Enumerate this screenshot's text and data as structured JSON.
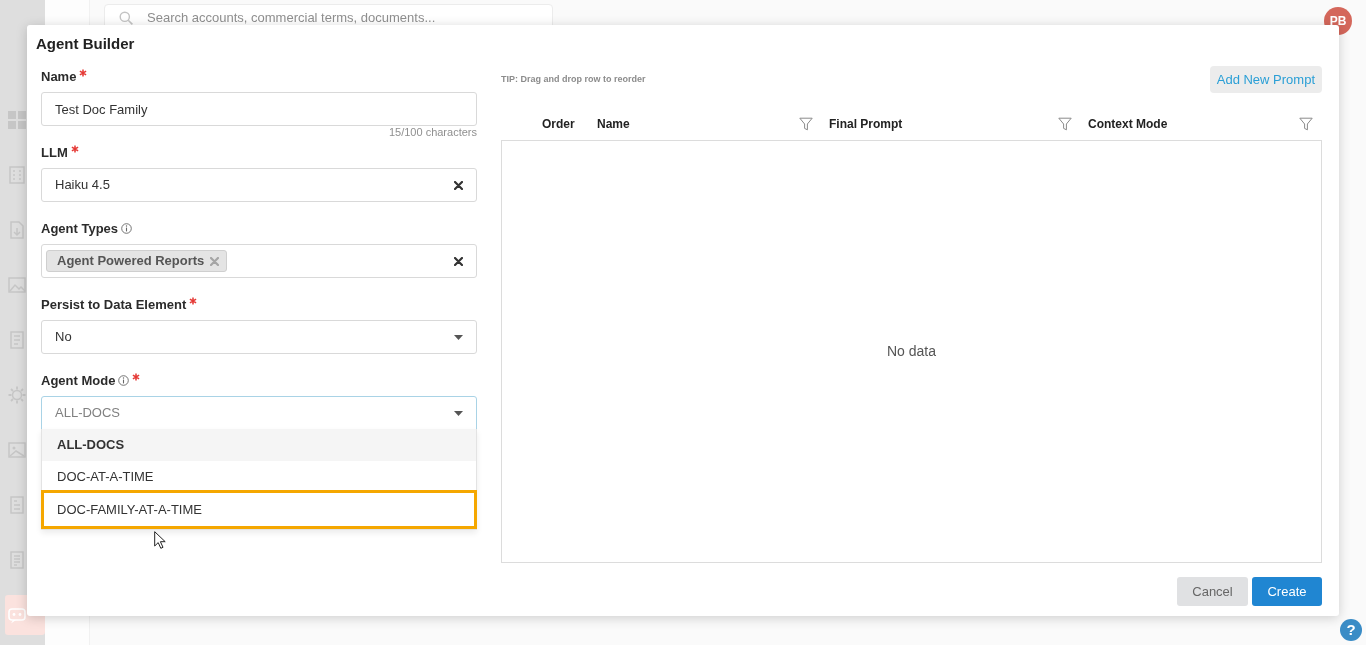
{
  "background": {
    "sidebar": {
      "items": [
        {
          "selected": false
        },
        {
          "selected": false
        },
        {
          "selected": false
        },
        {
          "selected": false
        },
        {
          "selected": false
        },
        {
          "selected": false
        },
        {
          "selected": false
        },
        {
          "selected": false
        },
        {
          "selected": false
        },
        {
          "selected": true
        }
      ]
    },
    "search": {
      "placeholder": "Search accounts, commercial terms, documents..."
    },
    "avatar": {
      "initials": "PB"
    },
    "help_button": {
      "label": "?"
    }
  },
  "dialog": {
    "title": "Agent Builder",
    "fields": [
      {
        "kind": "text",
        "label": "Name",
        "required": true,
        "value": "Test Doc Family",
        "counter": "15/100 characters"
      },
      {
        "kind": "select",
        "label": "LLM",
        "required": true,
        "value": "Haiku 4.5",
        "clearable": true,
        "open": false
      },
      {
        "kind": "multiselect",
        "label": "Agent Types",
        "info": true,
        "tags": [
          "Agent Powered Reports"
        ],
        "clearable": true
      },
      {
        "kind": "select",
        "label": "Persist to Data Element",
        "required": true,
        "value": "No",
        "clearable": false,
        "open": false
      },
      {
        "kind": "select",
        "label": "Agent Mode",
        "required": true,
        "info": true,
        "value": "ALL-DOCS",
        "clearable": false,
        "open": true,
        "options": [
          {
            "label": "ALL-DOCS",
            "selected": true,
            "highlighted": false
          },
          {
            "label": "DOC-AT-A-TIME",
            "selected": false,
            "highlighted": false
          },
          {
            "label": "DOC-FAMILY-AT-A-TIME",
            "selected": false,
            "highlighted": true
          }
        ]
      }
    ],
    "tip": "TIP: Drag and drop row to reorder",
    "add_button": "Add New Prompt",
    "table": {
      "columns": [
        {
          "label": "Order",
          "filter": false
        },
        {
          "label": "Name",
          "filter": true
        },
        {
          "label": "Final Prompt",
          "filter": true
        },
        {
          "label": "Context Mode",
          "filter": true
        }
      ],
      "empty_text": "No data"
    },
    "buttons": [
      {
        "label": "Cancel",
        "kind": "secondary"
      },
      {
        "label": "Create",
        "kind": "primary"
      }
    ]
  }
}
